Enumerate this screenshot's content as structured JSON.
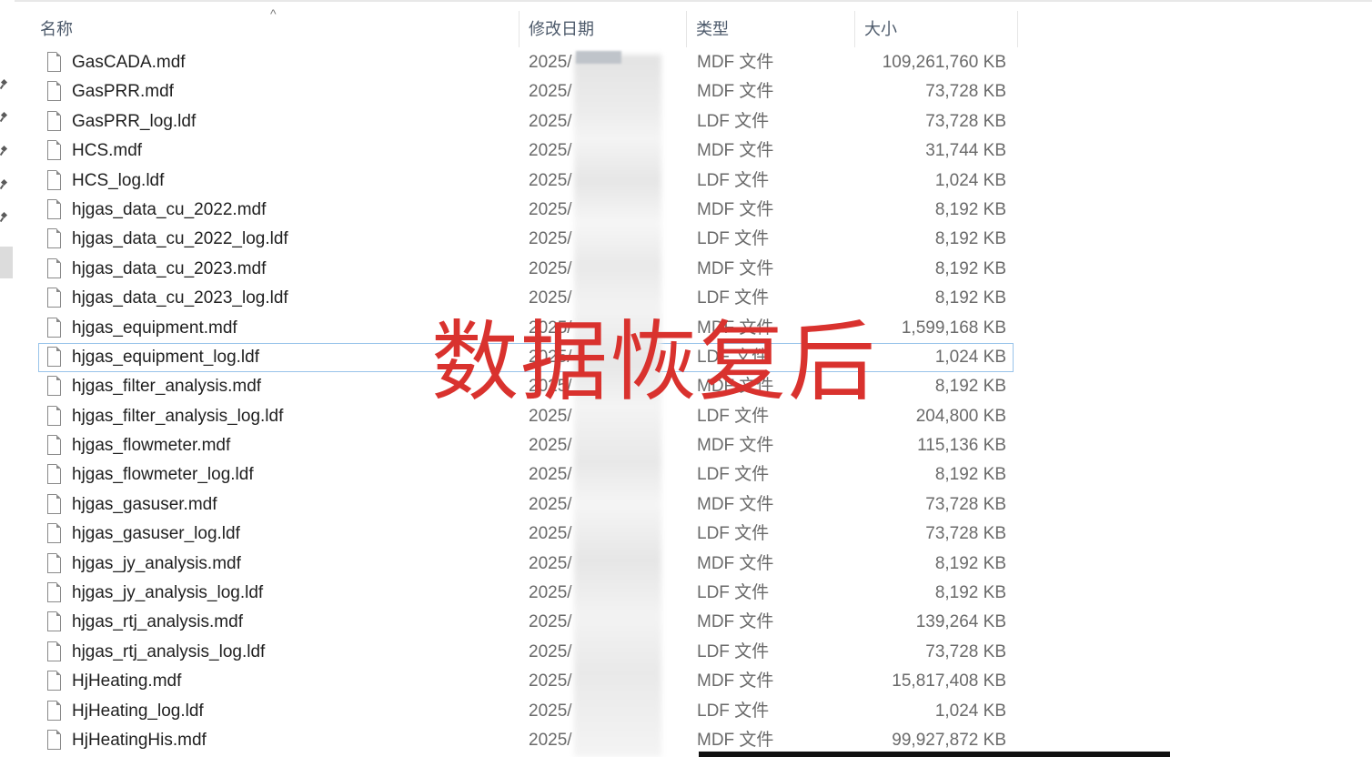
{
  "columns": {
    "name": "名称",
    "date": "修改日期",
    "type": "类型",
    "size": "大小"
  },
  "files": [
    {
      "name": "GasCADA.mdf",
      "date": "2025/",
      "type": "MDF 文件",
      "size": "109,261,760 KB"
    },
    {
      "name": "GasPRR.mdf",
      "date": "2025/",
      "type": "MDF 文件",
      "size": "73,728 KB"
    },
    {
      "name": "GasPRR_log.ldf",
      "date": "2025/",
      "type": "LDF 文件",
      "size": "73,728 KB"
    },
    {
      "name": "HCS.mdf",
      "date": "2025/",
      "type": "MDF 文件",
      "size": "31,744 KB"
    },
    {
      "name": "HCS_log.ldf",
      "date": "2025/",
      "type": "LDF 文件",
      "size": "1,024 KB"
    },
    {
      "name": "hjgas_data_cu_2022.mdf",
      "date": "2025/",
      "type": "MDF 文件",
      "size": "8,192 KB"
    },
    {
      "name": "hjgas_data_cu_2022_log.ldf",
      "date": "2025/",
      "type": "LDF 文件",
      "size": "8,192 KB"
    },
    {
      "name": "hjgas_data_cu_2023.mdf",
      "date": "2025/",
      "type": "MDF 文件",
      "size": "8,192 KB"
    },
    {
      "name": "hjgas_data_cu_2023_log.ldf",
      "date": "2025/",
      "type": "LDF 文件",
      "size": "8,192 KB"
    },
    {
      "name": "hjgas_equipment.mdf",
      "date": "2025/",
      "type": "MDF 文件",
      "size": "1,599,168 KB"
    },
    {
      "name": "hjgas_equipment_log.ldf",
      "date": "2025/",
      "type": "LDF 文件",
      "size": "1,024 KB"
    },
    {
      "name": "hjgas_filter_analysis.mdf",
      "date": "2025/",
      "type": "MDF 文件",
      "size": "8,192 KB"
    },
    {
      "name": "hjgas_filter_analysis_log.ldf",
      "date": "2025/",
      "type": "LDF 文件",
      "size": "204,800 KB"
    },
    {
      "name": "hjgas_flowmeter.mdf",
      "date": "2025/",
      "type": "MDF 文件",
      "size": "115,136 KB"
    },
    {
      "name": "hjgas_flowmeter_log.ldf",
      "date": "2025/",
      "type": "LDF 文件",
      "size": "8,192 KB"
    },
    {
      "name": "hjgas_gasuser.mdf",
      "date": "2025/",
      "type": "MDF 文件",
      "size": "73,728 KB"
    },
    {
      "name": "hjgas_gasuser_log.ldf",
      "date": "2025/",
      "type": "LDF 文件",
      "size": "73,728 KB"
    },
    {
      "name": "hjgas_jy_analysis.mdf",
      "date": "2025/",
      "type": "MDF 文件",
      "size": "8,192 KB"
    },
    {
      "name": "hjgas_jy_analysis_log.ldf",
      "date": "2025/",
      "type": "LDF 文件",
      "size": "8,192 KB"
    },
    {
      "name": "hjgas_rtj_analysis.mdf",
      "date": "2025/",
      "type": "MDF 文件",
      "size": "139,264 KB"
    },
    {
      "name": "hjgas_rtj_analysis_log.ldf",
      "date": "2025/",
      "type": "LDF 文件",
      "size": "73,728 KB"
    },
    {
      "name": "HjHeating.mdf",
      "date": "2025/",
      "type": "MDF 文件",
      "size": "15,817,408 KB"
    },
    {
      "name": "HjHeating_log.ldf",
      "date": "2025/",
      "type": "LDF 文件",
      "size": "1,024 KB"
    },
    {
      "name": "HjHeatingHis.mdf",
      "date": "2025/",
      "type": "MDF 文件",
      "size": "99,927,872 KB"
    }
  ],
  "overlay": {
    "text": "数据恢复后"
  },
  "selected_index": 10
}
